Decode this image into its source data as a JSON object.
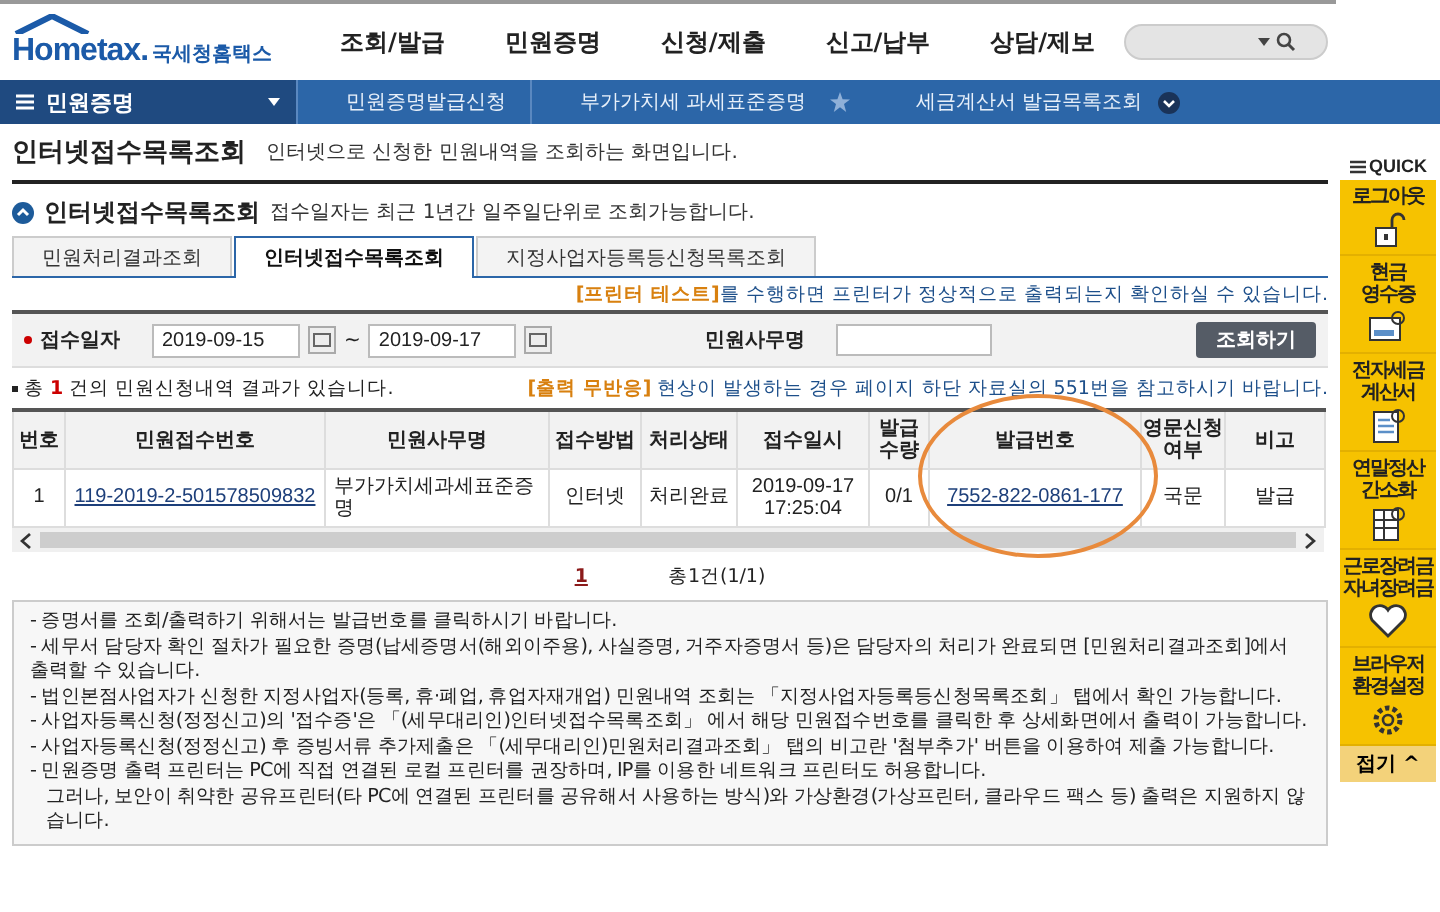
{
  "header": {
    "logo": "Hometax.",
    "logo_korean": "국세청홈택스",
    "nav": [
      "조회/발급",
      "민원증명",
      "신청/제출",
      "신고/납부",
      "상담/제보"
    ]
  },
  "subnav": {
    "menu": "민원증명",
    "breadcrumbs": [
      "민원증명발급신청",
      "부가가치세 과세표준증명"
    ],
    "ticker": "세금계산서 발급목록조회"
  },
  "page": {
    "title": "인터넷접수목록조회",
    "description": "인터넷으로 신청한 민원내역을 조회하는 화면입니다."
  },
  "section": {
    "title": "인터넷접수목록조회",
    "note": "접수일자는 최근 1년간 일주일단위로 조회가능합니다."
  },
  "tabs": [
    {
      "label": "민원처리결과조회",
      "selected": false
    },
    {
      "label": "인터넷접수목록조회",
      "selected": true
    },
    {
      "label": "지정사업자등록등신청목록조회",
      "selected": false
    }
  ],
  "printer_notice": {
    "link": "[프린터 테스트]",
    "text": "를 수행하면 프린터가 정상적으로 출력되는지 확인하실 수 있습니다."
  },
  "filter": {
    "date_label": "접수일자",
    "from": "2019-09-15",
    "separator": "~",
    "to": "2019-09-17",
    "name_label": "민원사무명",
    "button": "조회하기"
  },
  "result": {
    "prefix": "총",
    "count": "1",
    "suffix": "건의 민원신청내역 결과가 있습니다.",
    "notice_link": "[출력 무반응]",
    "notice_text": "현상이 발생하는 경우 페이지 하단 자료실의 551번을 참고하시기 바랍니다."
  },
  "table": {
    "columns": [
      "번호",
      "민원접수번호",
      "민원사무명",
      "접수방법",
      "처리상태",
      "접수일시",
      "발급\n수량",
      "발급번호",
      "영문신청\n여부",
      "비고"
    ],
    "rows": [
      {
        "no": "1",
        "receipt_no": "119-2019-2-501578509832",
        "name": "부가가치세과세표준증명",
        "method": "인터넷",
        "status": "처리완료",
        "datetime": "2019-09-17\n17:25:04",
        "quantity": "0/1",
        "issue_no": "7552-822-0861-177",
        "english": "국문",
        "note": "발급"
      }
    ]
  },
  "pagination": {
    "page": "1",
    "summary": "총1건(1/1)"
  },
  "notes": [
    "- 증명서를 조회/출력하기 위해서는 발급번호를 클릭하시기 바랍니다.",
    "- 세무서 담당자 확인 절차가 필요한 증명(납세증명서(해외이주용), 사실증명, 거주자증명서 등)은 담당자의 처리가 완료되면 [민원처리결과조회]에서 출력할 수 있습니다.",
    "- 법인본점사업자가 신청한 지정사업자(등록, 휴·폐업, 휴업자재개업) 민원내역 조회는 「지정사업자등록등신청목록조회」 탭에서 확인 가능합니다.",
    "- 사업자등록신청(정정신고)의 '접수증'은 「(세무대리인)인터넷접수목록조회」 에서 해당 민원접수번호를 클릭한 후 상세화면에서 출력이 가능합니다.",
    "- 사업자등록신청(정정신고) 후 증빙서류 추가제출은 「(세무대리인)민원처리결과조회」 탭의 비고란 '첨부추가' 버튼을 이용하여 제출 가능합니다.",
    "- 민원증명 출력 프린터는 PC에 직접 연결된 로컬 프린터를 권장하며, IP를 이용한 네트워크 프린터도 허용합니다.",
    "그러나, 보안이 취약한 공유프린터(타 PC에 연결된 프린터를 공유해서 사용하는 방식)와 가상환경(가상프린터, 클라우드 팩스 등) 출력은 지원하지 않습니다."
  ],
  "quick": {
    "title": "QUICK",
    "items": [
      "로그아웃",
      "현금\n영수증",
      "전자세금\n계산서",
      "연말정산\n간소화",
      "근로장려금\n자녀장려금",
      "브라우저\n환경설정"
    ],
    "collapse": "접기 ^"
  }
}
